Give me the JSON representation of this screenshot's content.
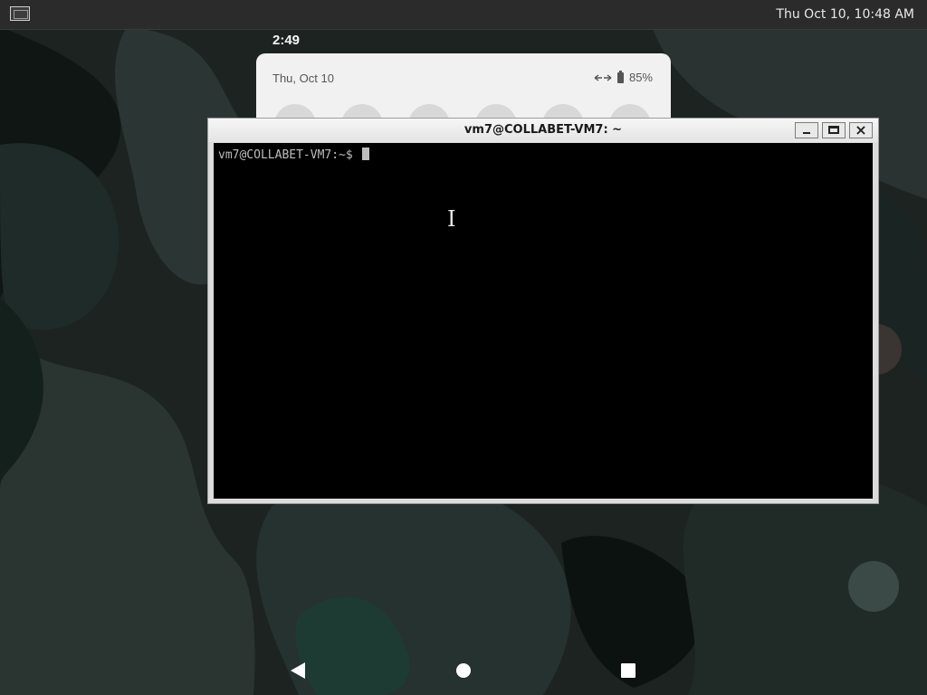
{
  "top_panel": {
    "clock": "Thu Oct 10, 10:48 AM"
  },
  "notification_shade": {
    "time": "2:49",
    "date": "Thu, Oct 10",
    "battery": "85%",
    "status_icons": [
      "data-transfer-icon",
      "battery-icon"
    ]
  },
  "terminal": {
    "title": "vm7@COLLABET-VM7: ~",
    "prompt": "vm7@COLLABET-VM7:~$ ",
    "buttons": {
      "minimize": "minimize",
      "maximize": "maximize",
      "close": "×"
    }
  },
  "navbar": {
    "items": [
      "back-icon",
      "home-icon",
      "recents-icon"
    ]
  },
  "colors": {
    "panel": "#2b2b2b",
    "terminal_bg": "#000000",
    "terminal_text": "#bdbdbd",
    "shade_card": "#f1f1f1"
  }
}
